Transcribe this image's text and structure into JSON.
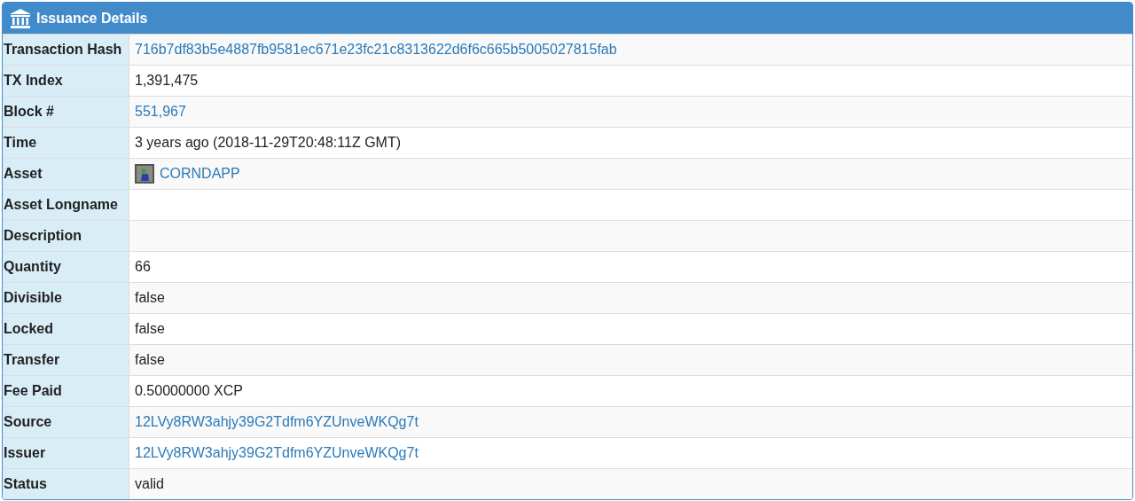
{
  "panel": {
    "title": "Issuance Details"
  },
  "rows": [
    {
      "label": "Transaction Hash",
      "kind": "link",
      "value": "716b7df83b5e4887fb9581ec671e23fc21c8313622d6f6c665b5005027815fab"
    },
    {
      "label": "TX Index",
      "kind": "text",
      "value": "1,391,475"
    },
    {
      "label": "Block #",
      "kind": "link",
      "value": "551,967"
    },
    {
      "label": "Time",
      "kind": "text",
      "value": "3 years ago (2018-11-29T20:48:11Z GMT)"
    },
    {
      "label": "Asset",
      "kind": "asset",
      "value": "CORNDAPP"
    },
    {
      "label": "Asset Longname",
      "kind": "empty"
    },
    {
      "label": "Description",
      "kind": "empty"
    },
    {
      "label": "Quantity",
      "kind": "text",
      "value": "66"
    },
    {
      "label": "Divisible",
      "kind": "text",
      "value": "false"
    },
    {
      "label": "Locked",
      "kind": "text",
      "value": "false"
    },
    {
      "label": "Transfer",
      "kind": "text",
      "value": "false"
    },
    {
      "label": "Fee Paid",
      "kind": "text",
      "value": "0.50000000 XCP"
    },
    {
      "label": "Source",
      "kind": "link",
      "value": "12LVy8RW3ahjy39G2Tdfm6YZUnveWKQg7t"
    },
    {
      "label": "Issuer",
      "kind": "link",
      "value": "12LVy8RW3ahjy39G2Tdfm6YZUnveWKQg7t"
    },
    {
      "label": "Status",
      "kind": "text",
      "value": "valid"
    }
  ]
}
